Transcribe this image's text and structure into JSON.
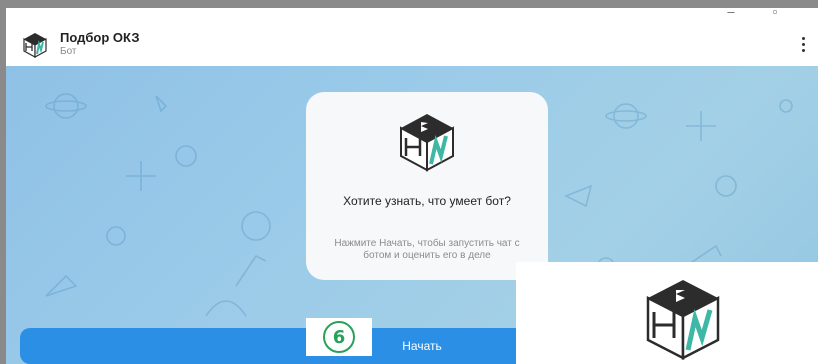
{
  "window": {
    "minimize_glyph": "–",
    "maximize_glyph": "▫"
  },
  "header": {
    "chat_name": "Подбор ОКЗ",
    "chat_status": "Бот",
    "avatar_icon": "cube-logo-icon",
    "menu_icon": "more-vertical-icon"
  },
  "intro": {
    "title": "Хотите узнать, что умеет бот?",
    "description": "Нажмите Начать, чтобы запустить чат с ботом и оценить его в деле"
  },
  "start_button": {
    "label": "Начать"
  },
  "step_badge": {
    "label": "6"
  },
  "colors": {
    "accent": "#2b8fe6",
    "badge": "#2aa05a",
    "logo_dark": "#2c2c2c",
    "logo_teal": "#3fb7a6"
  }
}
